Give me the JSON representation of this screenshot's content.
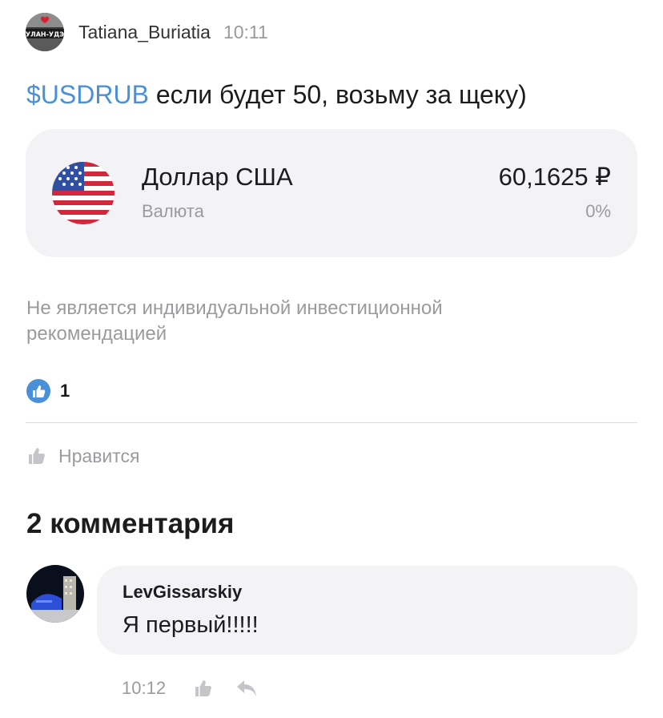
{
  "post": {
    "author": "Tatiana_Buriatia",
    "time": "10:11",
    "avatar_icon": "city-sign-avatar",
    "avatar_caption": "УЛАН-УДЭ",
    "ticker": "$USDRUB",
    "text": " если будет 50, возьму за щеку)"
  },
  "instrument": {
    "icon": "us-flag-icon",
    "name": "Доллар США",
    "type": "Валюта",
    "price": "60,1625 ₽",
    "change": "0%"
  },
  "disclaimer": "Не является индивидуальной инвестиционной рекомендацией",
  "reactions": {
    "icon": "thumbs-up-badge-icon",
    "count": "1"
  },
  "like_action": {
    "icon": "thumbs-up-icon",
    "label": "Нравится"
  },
  "comments": {
    "title": "2 комментария",
    "items": [
      {
        "author": "LevGissarskiy",
        "text": "Я первый!!!!!",
        "time": "10:12",
        "avatar_icon": "night-city-avatar"
      }
    ]
  },
  "colors": {
    "link": "#4a90d9",
    "secondary_text": "#9a9a9f",
    "card_background": "#f3f3f6",
    "flag_red": "#d3283b",
    "flag_blue": "#2f4fa3"
  }
}
